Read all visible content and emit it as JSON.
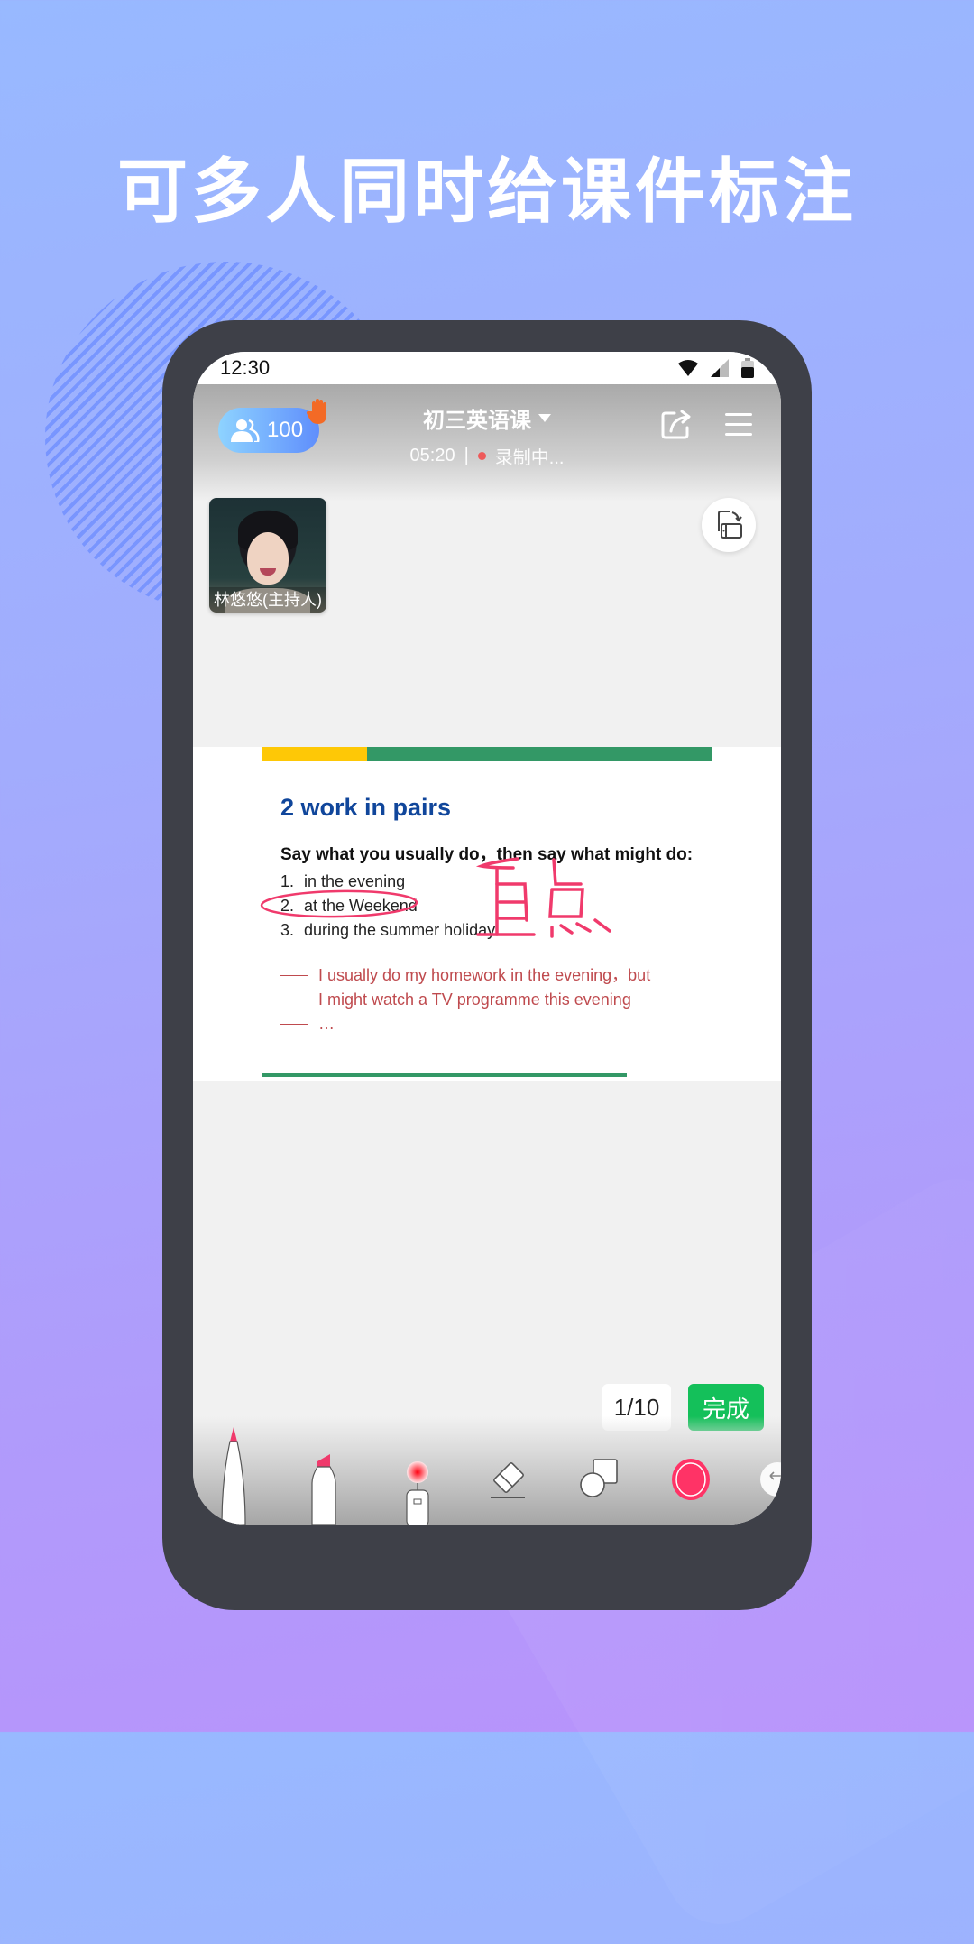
{
  "headline": "可多人同时给课件标注",
  "status_bar": {
    "time": "12:30"
  },
  "header": {
    "participant_count": "100",
    "course_title": "初三英语课",
    "elapsed": "05:20",
    "separator": "|",
    "recording_status": "录制中..."
  },
  "video": {
    "presenter_label": "林悠悠(主持人)"
  },
  "slide": {
    "heading": "2 work in pairs",
    "instruction": "Say what you usually do，then say what might do:",
    "items": [
      {
        "num": "1.",
        "text": "in the evening"
      },
      {
        "num": "2.",
        "text": "at the Weekend"
      },
      {
        "num": "3.",
        "text": "during the summer holiday"
      }
    ],
    "example_line1": "I usually do my homework in the evening，but",
    "example_line2": "I might watch a TV programme this evening",
    "example_more": "…",
    "annotation_text": "重点"
  },
  "pager": {
    "page": "1/10",
    "done_label": "完成"
  },
  "toolbar": {
    "tools": [
      "pen",
      "highlighter",
      "laser-pointer",
      "eraser",
      "shapes",
      "color-picker",
      "undo"
    ],
    "selected_color": "#ff3366"
  },
  "colors": {
    "accent_green": "#14c05a",
    "slide_green": "#339866",
    "slide_yellow": "#fec806",
    "heading_blue": "#10469b",
    "example_red": "#bf4a4e",
    "annotation_pink": "#f03a6c",
    "hand_orange": "#f36a26"
  }
}
